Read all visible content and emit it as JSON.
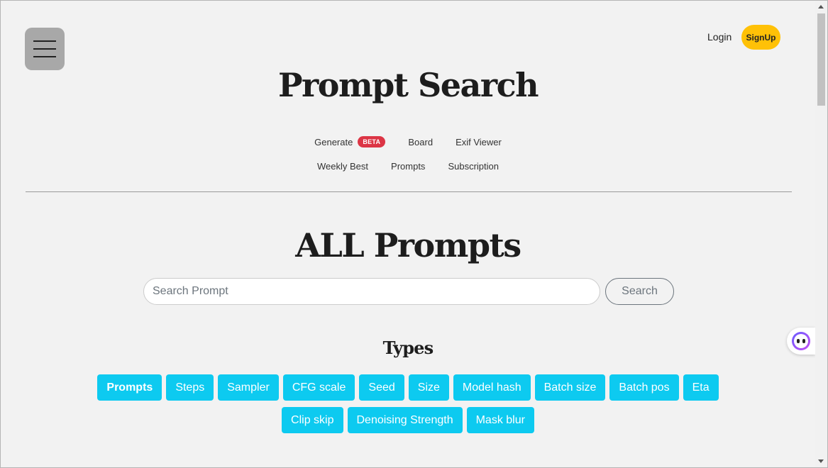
{
  "header": {
    "login_label": "Login",
    "signup_label": "SignUp",
    "site_title": "Prompt Search"
  },
  "nav": {
    "row1": [
      {
        "label": "Generate",
        "badge": "BETA"
      },
      {
        "label": "Board"
      },
      {
        "label": "Exif Viewer"
      }
    ],
    "row2": [
      {
        "label": "Weekly Best"
      },
      {
        "label": "Prompts"
      },
      {
        "label": "Subscription"
      }
    ]
  },
  "main": {
    "title": "ALL Prompts",
    "search_placeholder": "Search Prompt",
    "search_button": "Search",
    "types_title": "Types",
    "types": [
      "Prompts",
      "Steps",
      "Sampler",
      "CFG scale",
      "Seed",
      "Size",
      "Model hash",
      "Batch size",
      "Batch pos",
      "Eta",
      "Clip skip",
      "Denoising Strength",
      "Mask blur"
    ],
    "active_type": "Prompts"
  },
  "colors": {
    "accent_tag": "#0dcaf0",
    "signup": "#ffc107",
    "beta_badge": "#dc3545",
    "background": "#f2f2f2"
  },
  "icons": {
    "menu": "hamburger-icon",
    "chat": "chat-assistant-icon"
  }
}
